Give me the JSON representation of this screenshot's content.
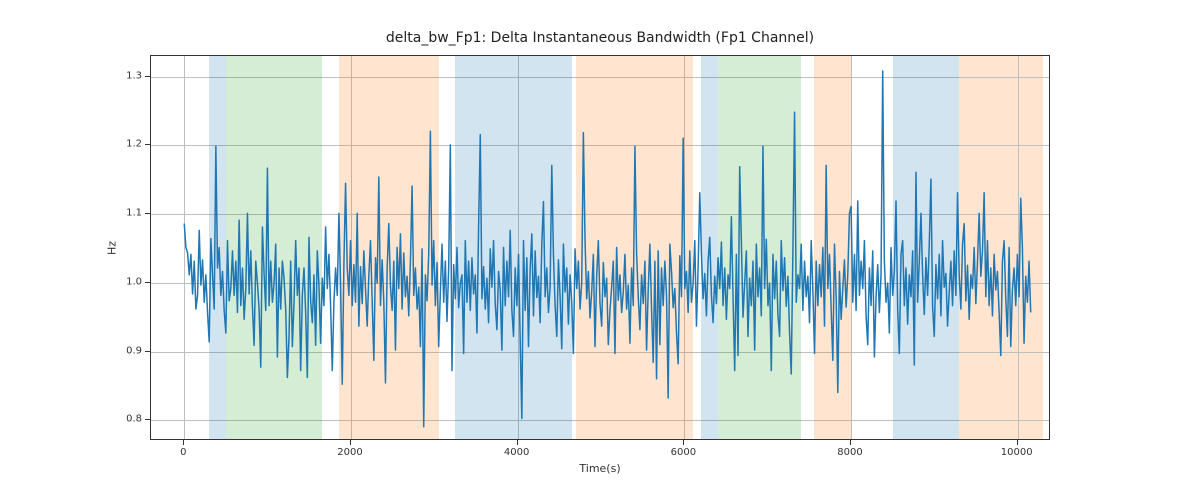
{
  "chart_data": {
    "type": "line",
    "title": "delta_bw_Fp1: Delta Instantaneous Bandwidth (Fp1 Channel)",
    "xlabel": "Time(s)",
    "ylabel": "Hz",
    "xlim": [
      -400,
      10400
    ],
    "ylim": [
      0.77,
      1.33
    ],
    "xticks": [
      0,
      2000,
      4000,
      6000,
      8000,
      10000
    ],
    "yticks": [
      0.8,
      0.9,
      1.0,
      1.1,
      1.2,
      1.3
    ],
    "bands": [
      {
        "x0": 300,
        "x1": 500,
        "color": "#1f77b4"
      },
      {
        "x0": 500,
        "x1": 1650,
        "color": "#2ca02c"
      },
      {
        "x0": 1850,
        "x1": 3050,
        "color": "#ff7f0e"
      },
      {
        "x0": 3250,
        "x1": 4650,
        "color": "#1f77b4"
      },
      {
        "x0": 4700,
        "x1": 6100,
        "color": "#ff7f0e"
      },
      {
        "x0": 6200,
        "x1": 6400,
        "color": "#1f77b4"
      },
      {
        "x0": 6400,
        "x1": 7400,
        "color": "#2ca02c"
      },
      {
        "x0": 7550,
        "x1": 8000,
        "color": "#ff7f0e"
      },
      {
        "x0": 8500,
        "x1": 9300,
        "color": "#1f77b4"
      },
      {
        "x0": 9300,
        "x1": 10300,
        "color": "#ff7f0e"
      }
    ],
    "series": [
      {
        "name": "delta_bw_Fp1",
        "color": "#1f77b4",
        "x_start": 0,
        "x_step": 20,
        "values": [
          1.085,
          1.05,
          1.042,
          1.01,
          1.04,
          0.982,
          1.03,
          0.96,
          0.98,
          1.075,
          0.995,
          1.032,
          0.97,
          1.01,
          0.955,
          0.912,
          1.063,
          1.01,
          0.96,
          1.198,
          1.02,
          1.05,
          0.98,
          1.015,
          0.958,
          0.925,
          1.06,
          0.972,
          0.99,
          1.045,
          0.98,
          1.03,
          0.955,
          1.09,
          0.965,
          1.02,
          0.945,
          0.99,
          1.1,
          0.982,
          1.045,
          0.963,
          0.907,
          1.03,
          0.998,
          0.96,
          0.875,
          1.08,
          1.012,
          0.958,
          1.166,
          0.965,
          1.03,
          0.97,
          0.998,
          1.055,
          0.89,
          1.02,
          0.96,
          1.03,
          1.005,
          0.96,
          0.86,
          0.92,
          1.03,
          0.905,
          0.97,
          1.06,
          0.98,
          1.02,
          0.87,
          0.98,
          1.02,
          0.955,
          0.86,
          1.065,
          0.972,
          0.94,
          1.01,
          0.907,
          1.045,
          0.995,
          0.91,
          1.005,
          0.965,
          1.08,
          0.99,
          1.04,
          0.965,
          0.87,
          0.97,
          1.02,
          0.98,
          1.1,
          0.995,
          0.85,
          1.025,
          1.144,
          1.02,
          0.98,
          1.06,
          0.965,
          1.025,
          0.97,
          1.1,
          0.935,
          1.022,
          0.968,
          1.045,
          0.99,
          0.935,
          1.01,
          1.06,
          0.972,
          0.885,
          1.035,
          0.998,
          1.153,
          0.965,
          1.032,
          0.97,
          0.852,
          1.02,
          1.085,
          0.993,
          0.958,
          1.03,
          0.9,
          1.05,
          0.99,
          1.07,
          0.96,
          1.042,
          0.978,
          1.008,
          0.95,
          1.03,
          1.14,
          0.98,
          1.02,
          0.96,
          0.992,
          0.905,
          1.048,
          0.788,
          1.01,
          0.972,
          1.04,
          1.22,
          0.995,
          1.06,
          0.965,
          1.028,
          0.905,
          0.985,
          1.055,
          0.97,
          1.03,
          0.942,
          1.02,
          1.2,
          0.87,
          1.025,
          0.975,
          1.05,
          0.962,
          0.998,
          1.01,
          0.895,
          1.06,
          0.97,
          1.03,
          0.958,
          1.035,
          0.982,
          1.01,
          0.925,
          1.08,
          1.215,
          0.975,
          1.022,
          0.96,
          1.005,
          0.94,
          1.048,
          0.992,
          1.06,
          0.967,
          0.93,
          1.015,
          0.988,
          0.9,
          1.05,
          0.965,
          1.03,
          0.978,
          1.075,
          0.958,
          0.92,
          1.02,
          0.965,
          1.04,
          0.915,
          0.8,
          1.06,
          0.958,
          1.035,
          0.905,
          1.018,
          1.07,
          0.95,
          1.045,
          0.977,
          1.008,
          0.94,
          1.055,
          1.117,
          0.978,
          1.02,
          0.955,
          0.992,
          1.17,
          1.04,
          0.965,
          0.92,
          1.032,
          0.978,
          0.902,
          1.055,
          0.985,
          1.02,
          0.938,
          1.01,
          0.97,
          0.895,
          1.048,
          0.99,
          1.03,
          0.96,
          0.998,
          1.218,
          1.06,
          0.975,
          1.015,
          0.947,
          0.985,
          1.04,
          0.905,
          1.008,
          1.06,
          0.968,
          0.935,
          1.028,
          0.978,
          1.005,
          0.908,
          0.958,
          0.992,
          1.03,
          0.895,
          1.05,
          0.973,
          1.01,
          0.955,
          0.985,
          1.04,
          0.96,
          0.995,
          0.91,
          1.02,
          0.965,
          1.198,
          1.042,
          0.978,
          0.93,
          1.01,
          0.968,
          1.03,
          0.9,
          0.988,
          1.055,
          0.96,
          0.882,
          1.03,
          0.858,
          1.045,
          0.908,
          1.02,
          0.965,
          1.03,
          0.98,
          0.83,
          1.055,
          1.015,
          0.962,
          0.99,
          0.925,
          0.88,
          1.038,
          0.978,
          1.21,
          0.99,
          1.015,
          0.955,
          1.045,
          0.97,
          0.998,
          1.06,
          0.935,
          1.02,
          1.13,
          1.04,
          0.975,
          1.012,
          0.95,
          1.03,
          1.065,
          0.98,
          0.94,
          1.008,
          0.968,
          1.035,
          0.99,
          1.058,
          0.965,
          1.02,
          0.945,
          1.01,
          0.99,
          1.095,
          0.978,
          0.87,
          1.04,
          0.892,
          1.168,
          1.06,
          0.948,
          0.998,
          1.045,
          0.92,
          1.005,
          0.965,
          1.03,
          0.9,
          1.055,
          0.978,
          1.02,
          0.95,
          1.198,
          0.99,
          1.062,
          0.965,
          0.998,
          0.87,
          1.04,
          0.975,
          1.03,
          0.952,
          0.92,
          1.06,
          0.987,
          1.035,
          0.964,
          1.008,
          0.925,
          0.865,
          1.045,
          1.248,
          0.97,
          1.01,
          0.99,
          1.055,
          0.958,
          1.03,
          0.978,
          1.008,
          0.94,
          1.06,
          0.988,
          0.895,
          1.03,
          0.965,
          1.025,
          0.978,
          1.05,
          0.935,
          1.17,
          0.99,
          1.04,
          0.96,
          0.885,
          1.055,
          0.978,
          0.838,
          1.015,
          0.945,
          0.99,
          1.032,
          0.963,
          1.01,
          1.1,
          1.11,
          0.97,
          1.04,
          0.958,
          1.118,
          0.98,
          1.03,
          0.99,
          1.06,
          0.95,
          0.908,
          1.02,
          0.965,
          1.045,
          0.89,
          0.978,
          1.025,
          0.955,
          1.01,
          1.308,
          1.03,
          0.97,
          0.998,
          0.925,
          1.05,
          0.98,
          1.015,
          1.118,
          0.96,
          0.895,
          1.04,
          1.06,
          0.965,
          1.02,
          0.938,
          1.01,
          0.978,
          1.045,
          0.878,
          1.16,
          0.97,
          1.03,
          1.1,
          1.01,
          0.952,
          1.035,
          0.98,
          1.055,
          1.15,
          0.964,
          0.92,
          1.025,
          0.975,
          1.04,
          0.95,
          1.06,
          0.992,
          1.012,
          0.935,
          0.985,
          1.03,
          0.965,
          1.045,
          0.98,
          1.13,
          1.01,
          0.96,
          1.055,
          1.085,
          0.972,
          1.024,
          0.945,
          1.01,
          0.99,
          1.05,
          0.968,
          1.03,
          1.1,
          1.008,
          1.045,
          1.13,
          0.978,
          1.06,
          0.965,
          1.02,
          0.95,
          1.04,
          0.988,
          1.015,
          0.955,
          0.892,
          1.03,
          1.06,
          0.975,
          0.92,
          1.05,
          0.905,
          0.988,
          1.02,
          0.965,
          1.04,
          0.978,
          1.122,
          1.05,
          0.91,
          1.008,
          0.97,
          1.03,
          0.955
        ]
      }
    ]
  }
}
